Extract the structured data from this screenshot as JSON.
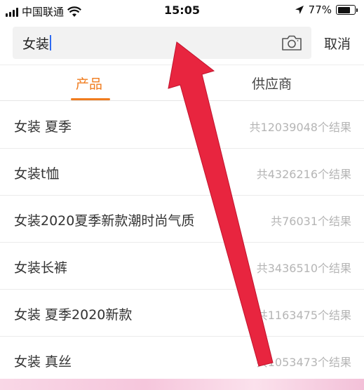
{
  "status_bar": {
    "carrier": "中国联通",
    "time": "15:05",
    "battery_text": "77%",
    "battery_level": 0.77
  },
  "search": {
    "query": "女装",
    "cancel_label": "取消",
    "camera_icon": "camera-icon"
  },
  "tabs": [
    {
      "label": "产品",
      "active": true
    },
    {
      "label": "供应商",
      "active": false
    }
  ],
  "suggestions": [
    {
      "label": "女装 夏季",
      "count": "共12039048个结果"
    },
    {
      "label": "女装t恤",
      "count": "共4326216个结果"
    },
    {
      "label": "女装2020夏季新款潮时尚气质",
      "count": "共76031个结果"
    },
    {
      "label": "女装长裤",
      "count": "共3436510个结果"
    },
    {
      "label": "女装 夏季2020新款",
      "count": "共1163475个结果"
    },
    {
      "label": "女装 真丝",
      "count": "共1053473个结果"
    }
  ],
  "colors": {
    "accent": "#f07c1e",
    "annotation_arrow": "#e8253f"
  }
}
